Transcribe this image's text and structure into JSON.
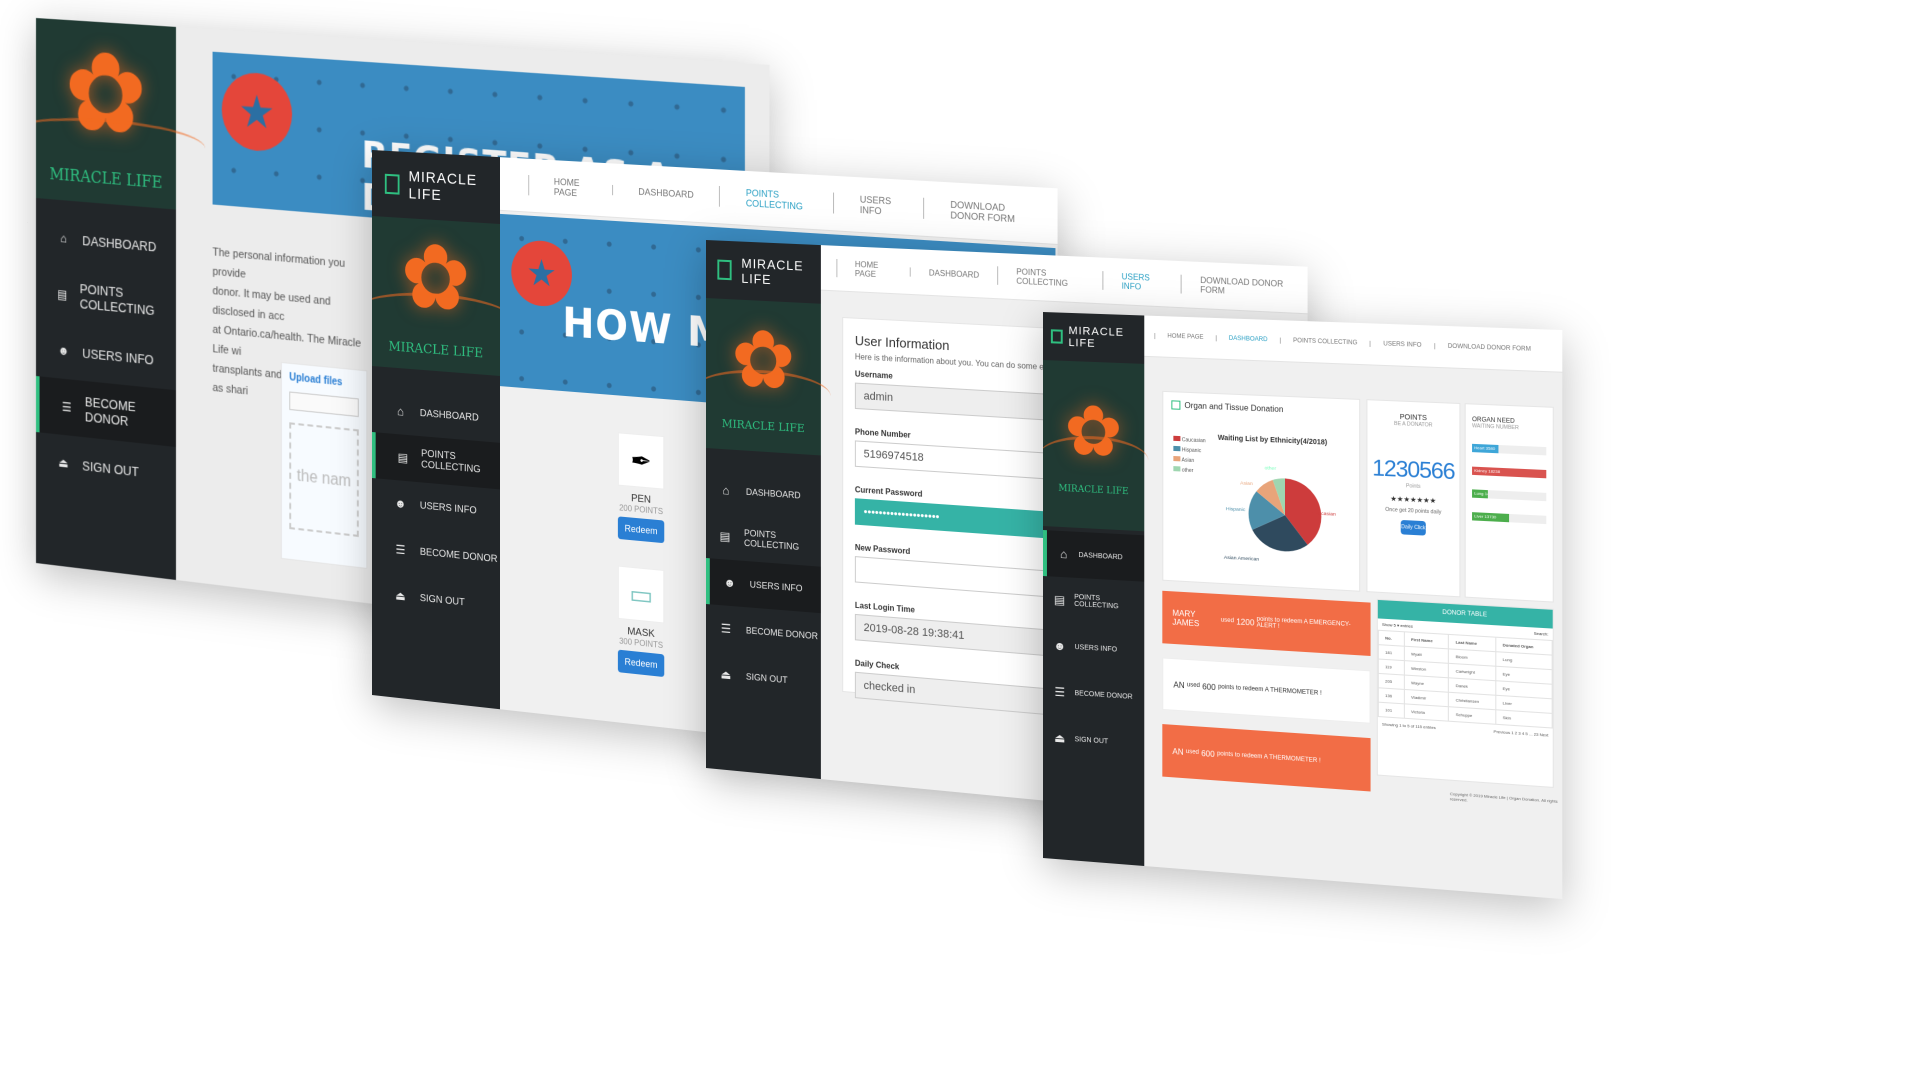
{
  "brand": {
    "name": "MIRACLE LIFE",
    "logo_text": "MIRACLE LIFE"
  },
  "colors": {
    "accent": "#2fbf80",
    "sidebar": "#222629",
    "orange": "#f26d46",
    "banner": "#3b8cc2",
    "teal": "#35b3a6"
  },
  "topnav": {
    "home": "HOME PAGE",
    "dashboard": "DASHBOARD",
    "points": "POINTS COLLECTING",
    "users": "USERS INFO",
    "download": "DOWNLOAD DONOR FORM"
  },
  "sidebar": {
    "dashboard": "DASHBOARD",
    "points": "POINTS COLLECTING",
    "users": "USERS INFO",
    "become": "BECOME DONOR",
    "signout": "SIGN OUT"
  },
  "screen1": {
    "banner_title": "REGISTER AS A DONOR!",
    "paragraph_lines": [
      "The personal information you provide",
      "donor. It may be used and disclosed in acc",
      "at Ontario.ca/health. The Miracle Life wi",
      "transplants and research as well as shari"
    ],
    "upload_label": "Upload files",
    "drop_text": "the nam"
  },
  "screen2": {
    "banner_title": "HOW MA",
    "items": [
      {
        "name": "PEN",
        "points": "200 POINTS",
        "button": "Redeem"
      },
      {
        "name": "MASK",
        "points": "300 POINTS",
        "button": "Redeem"
      }
    ]
  },
  "screen3": {
    "title": "User Information",
    "subtitle": "Here is the information about you. You can do some edit here!",
    "username_label": "Username",
    "username_value": "admin",
    "phone_label": "Phone Number",
    "phone_value": "5196974518",
    "current_pw_label": "Current Password",
    "current_pw_value": "••••••••••••••••••••",
    "new_pw_label": "New Password",
    "last_login_label": "Last Login Time",
    "last_login_value": "2019-08-28 19:38:41",
    "daily_label": "Daily Check",
    "daily_value": "checked in"
  },
  "screen4": {
    "organ_title": "Organ and Tissue Donation",
    "chart_title": "Waiting List by Ethnicity(4/2018)",
    "legend": [
      "Caucasian",
      "Hispanic",
      "Asian",
      "other"
    ],
    "slice_labels": [
      "Caucasian",
      "Hispanic",
      "Asian",
      "other",
      "Asian American"
    ],
    "points_title": "POINTS",
    "points_sub": "BE A DONATOR",
    "points_value": "1230566",
    "points_unit": "Points",
    "stars": "★★★★★★★",
    "once_text": "Once get 20 points daily",
    "daily_btn": "Daily Click",
    "need_title": "ORGAN NEED",
    "need_sub": "WAITING NUMBER",
    "need_bars": [
      {
        "label": "Heart 3580",
        "pct": 35,
        "color": "#3ea6d8"
      },
      {
        "label": "Kidney 18238",
        "pct": 100,
        "color": "#d9534f"
      },
      {
        "label": "Lung 1480",
        "pct": 22,
        "color": "#4cae4c"
      },
      {
        "label": "Liver 13730",
        "pct": 50,
        "color": "#4cae4c"
      }
    ],
    "alerts": [
      {
        "who": "MARY JAMES",
        "used": "used",
        "pts": "1200",
        "rest": "points to redeem A EMERGENCY-ALERT !"
      },
      {
        "who": "AN",
        "used": "used",
        "pts": "600",
        "rest": "points to redeem A THERMOMETER !"
      },
      {
        "who": "AN",
        "used": "used",
        "pts": "600",
        "rest": "points to redeem A THERMOMETER !"
      }
    ],
    "table_title": "DONOR TABLE",
    "show_text": "Show 5 ▾ entries",
    "search_text": "Search:",
    "columns": [
      "No.",
      "First Name",
      "Last Name",
      "Donated Organ"
    ],
    "rows": [
      [
        "181",
        "Wyatt",
        "Bloom",
        "Lung"
      ],
      [
        "119",
        "Winston",
        "Cartwright",
        "Eye"
      ],
      [
        "205",
        "Wayne",
        "Danek",
        "Eye"
      ],
      [
        "136",
        "Vladimir",
        "Christiansen",
        "Liver"
      ],
      [
        "101",
        "Victoria",
        "Schuppe",
        "Skin"
      ]
    ],
    "showing": "Showing 1 to 5 of 115 entries",
    "pager": "Previous 1 2 3 4 5 ... 23 Next",
    "copyright": "Copyright © 2019 Miracle Life | Organ Donation. All rights reserved."
  }
}
